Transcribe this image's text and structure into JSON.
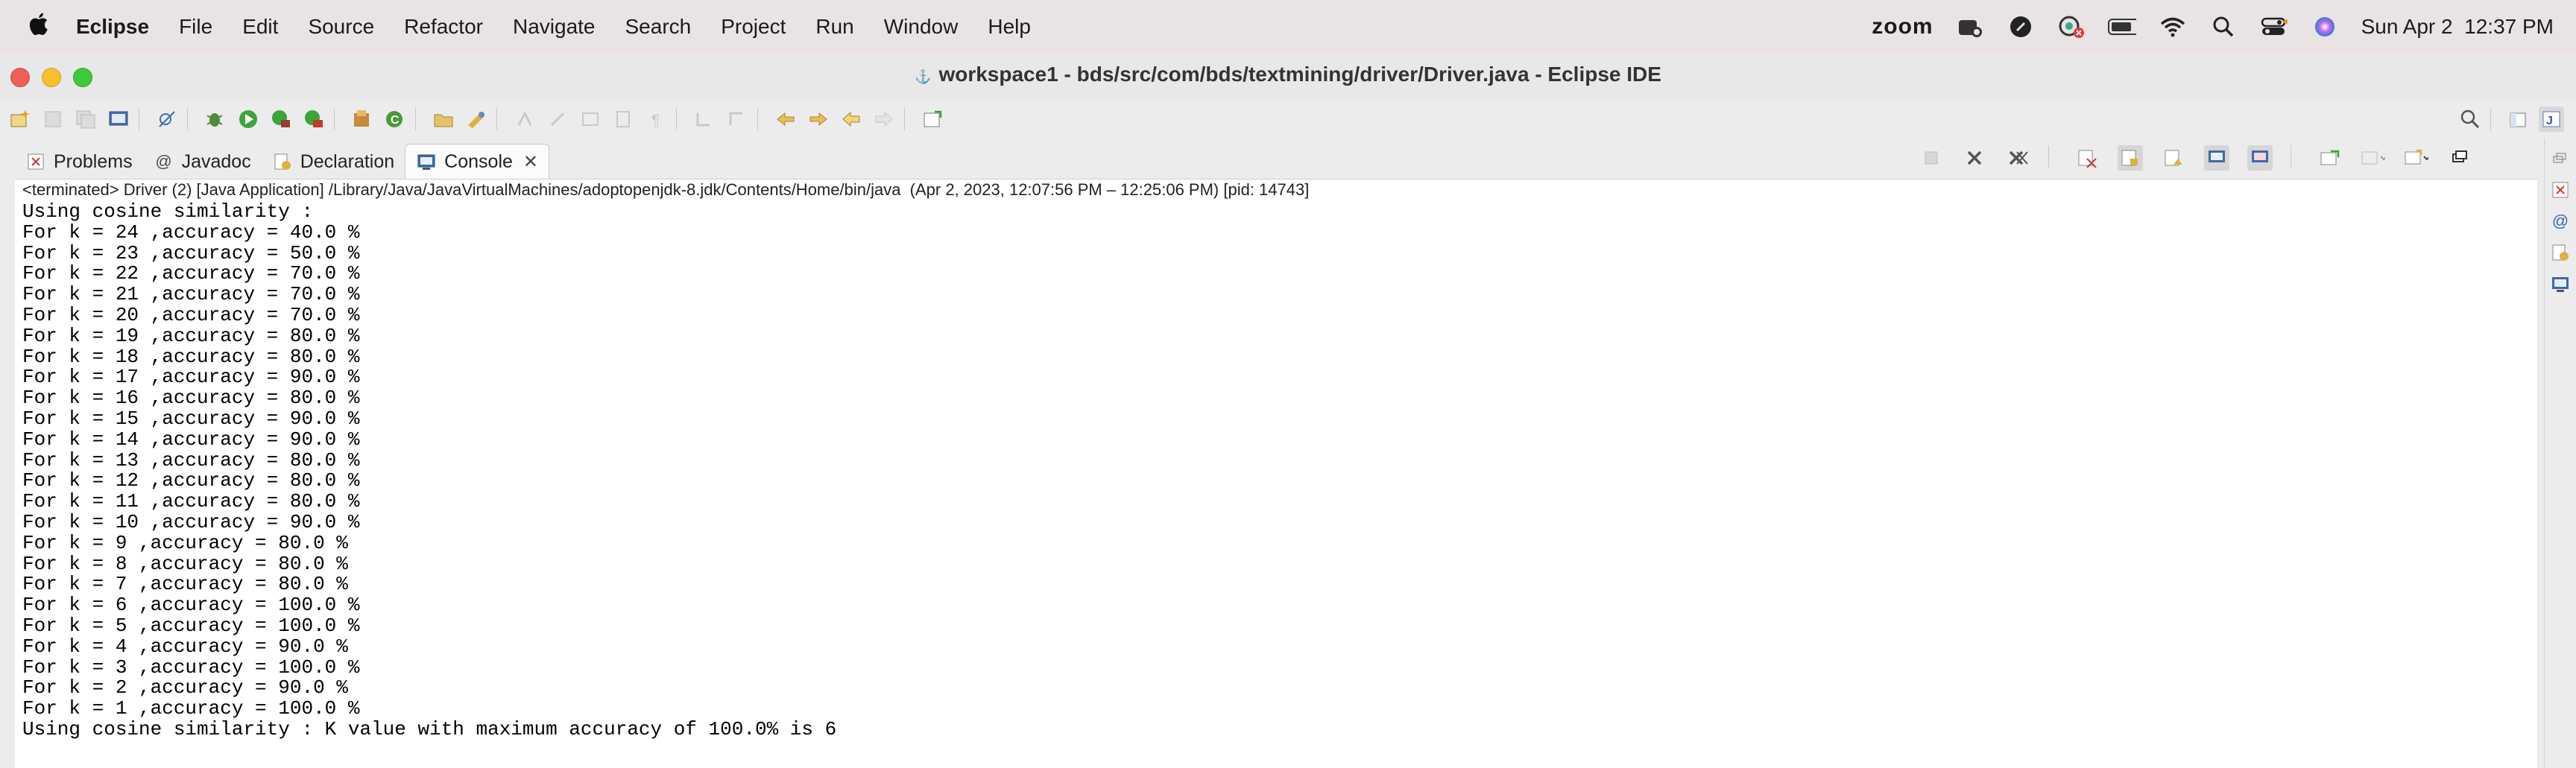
{
  "menubar": {
    "apple_icon": "apple-icon",
    "app_name": "Eclipse",
    "items": [
      "File",
      "Edit",
      "Source",
      "Refactor",
      "Navigate",
      "Search",
      "Project",
      "Run",
      "Window",
      "Help"
    ],
    "zoom_label": "zoom",
    "date_time": "Sun Apr 2  12:37 PM"
  },
  "window": {
    "title": "workspace1 - bds/src/com/bds/textmining/driver/Driver.java - Eclipse IDE"
  },
  "views": {
    "tabs": [
      {
        "label": "Problems",
        "icon": "problems-icon"
      },
      {
        "label": "Javadoc",
        "icon": "at-sign-icon"
      },
      {
        "label": "Declaration",
        "icon": "declaration-icon"
      },
      {
        "label": "Console",
        "icon": "console-icon",
        "active": true
      }
    ]
  },
  "console": {
    "launch_info": "<terminated> Driver (2) [Java Application] /Library/Java/JavaVirtualMachines/adoptopenjdk-8.jdk/Contents/Home/bin/java  (Apr 2, 2023, 12:07:56 PM – 12:25:06 PM) [pid: 14743]",
    "lines": [
      "Using cosine similarity :",
      "For k = 24 ,accuracy = 40.0 %",
      "For k = 23 ,accuracy = 50.0 %",
      "For k = 22 ,accuracy = 70.0 %",
      "For k = 21 ,accuracy = 70.0 %",
      "For k = 20 ,accuracy = 70.0 %",
      "For k = 19 ,accuracy = 80.0 %",
      "For k = 18 ,accuracy = 80.0 %",
      "For k = 17 ,accuracy = 90.0 %",
      "For k = 16 ,accuracy = 80.0 %",
      "For k = 15 ,accuracy = 90.0 %",
      "For k = 14 ,accuracy = 90.0 %",
      "For k = 13 ,accuracy = 80.0 %",
      "For k = 12 ,accuracy = 80.0 %",
      "For k = 11 ,accuracy = 80.0 %",
      "For k = 10 ,accuracy = 90.0 %",
      "For k = 9 ,accuracy = 80.0 %",
      "For k = 8 ,accuracy = 80.0 %",
      "For k = 7 ,accuracy = 80.0 %",
      "For k = 6 ,accuracy = 100.0 %",
      "For k = 5 ,accuracy = 100.0 %",
      "For k = 4 ,accuracy = 90.0 %",
      "For k = 3 ,accuracy = 100.0 %",
      "For k = 2 ,accuracy = 90.0 %",
      "For k = 1 ,accuracy = 100.0 %",
      "Using cosine similarity : K value with maximum accuracy of 100.0% is 6"
    ]
  },
  "colors": {
    "close": "#ee5f58",
    "minimize": "#f7be2f",
    "maximize": "#3ec83d"
  }
}
